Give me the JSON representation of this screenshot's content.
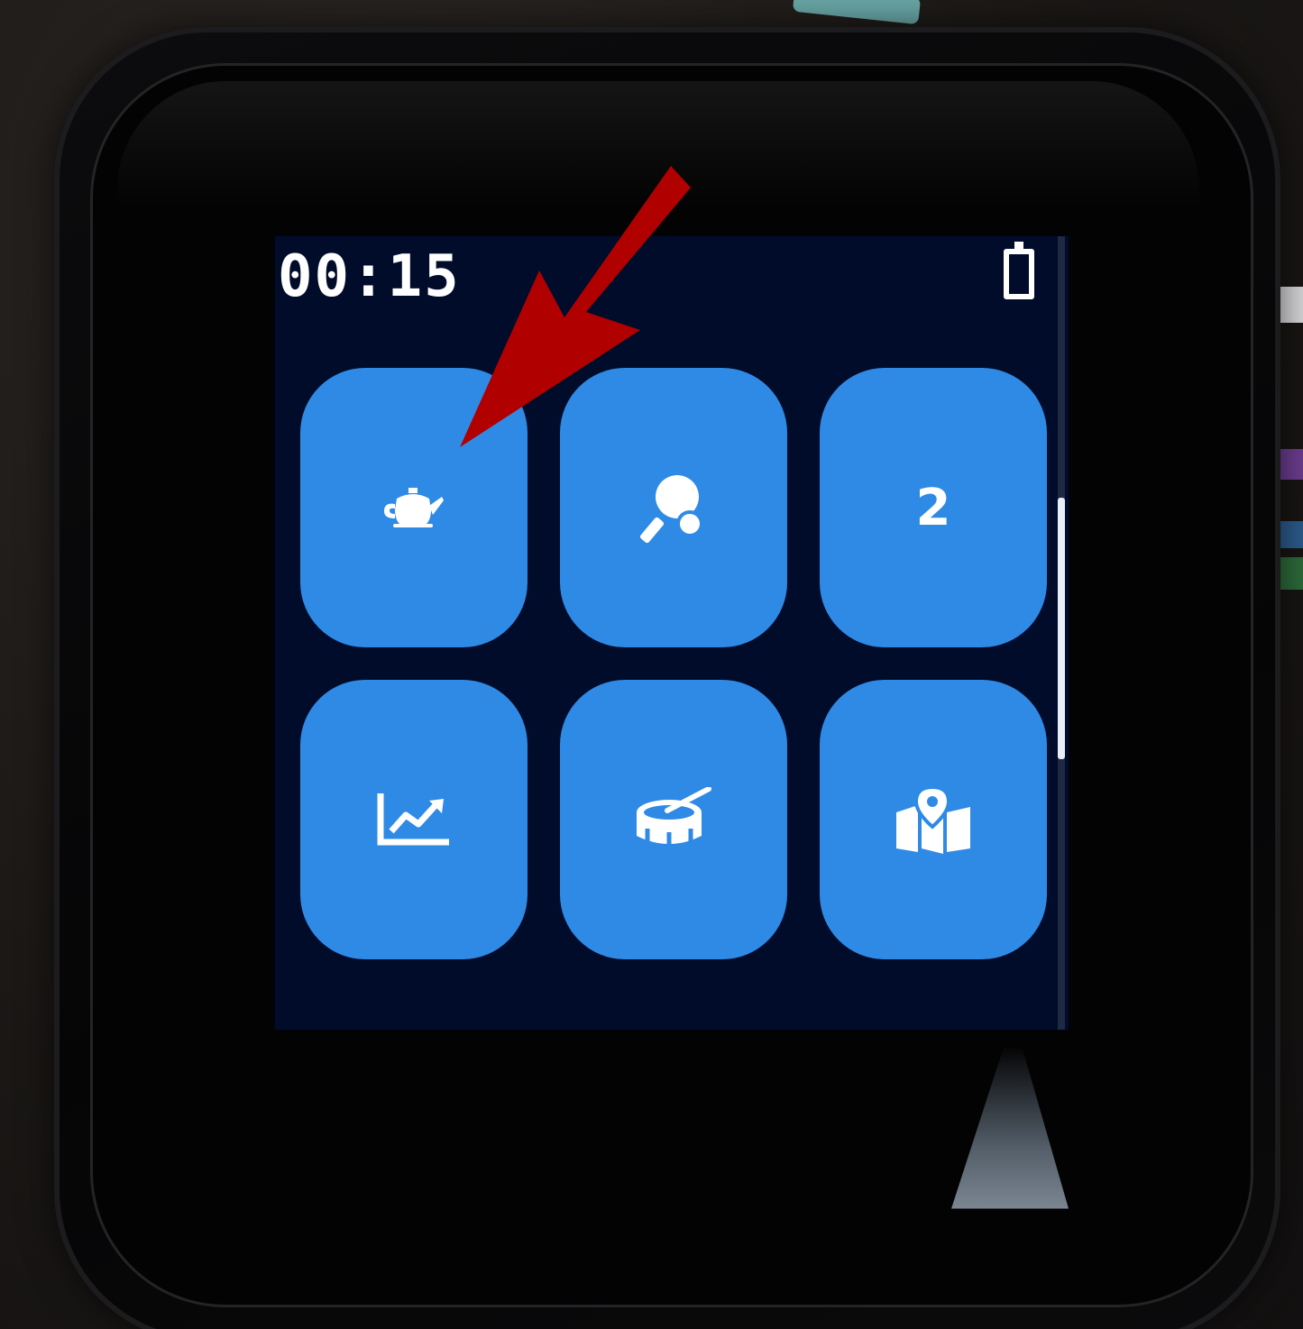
{
  "status_bar": {
    "time": "00:15",
    "battery_icon": "battery-icon"
  },
  "tiles": [
    {
      "icon": "teapot-icon",
      "label": ""
    },
    {
      "icon": "ping-pong-icon",
      "label": ""
    },
    {
      "icon": "",
      "label": "2"
    },
    {
      "icon": "chart-line-icon",
      "label": ""
    },
    {
      "icon": "drum-icon",
      "label": ""
    },
    {
      "icon": "map-location-icon",
      "label": ""
    }
  ],
  "colors": {
    "screen_background": "#000c2a",
    "tile": "#2f8ae6",
    "foreground": "#ffffff",
    "annotation_arrow": "#b00000"
  }
}
